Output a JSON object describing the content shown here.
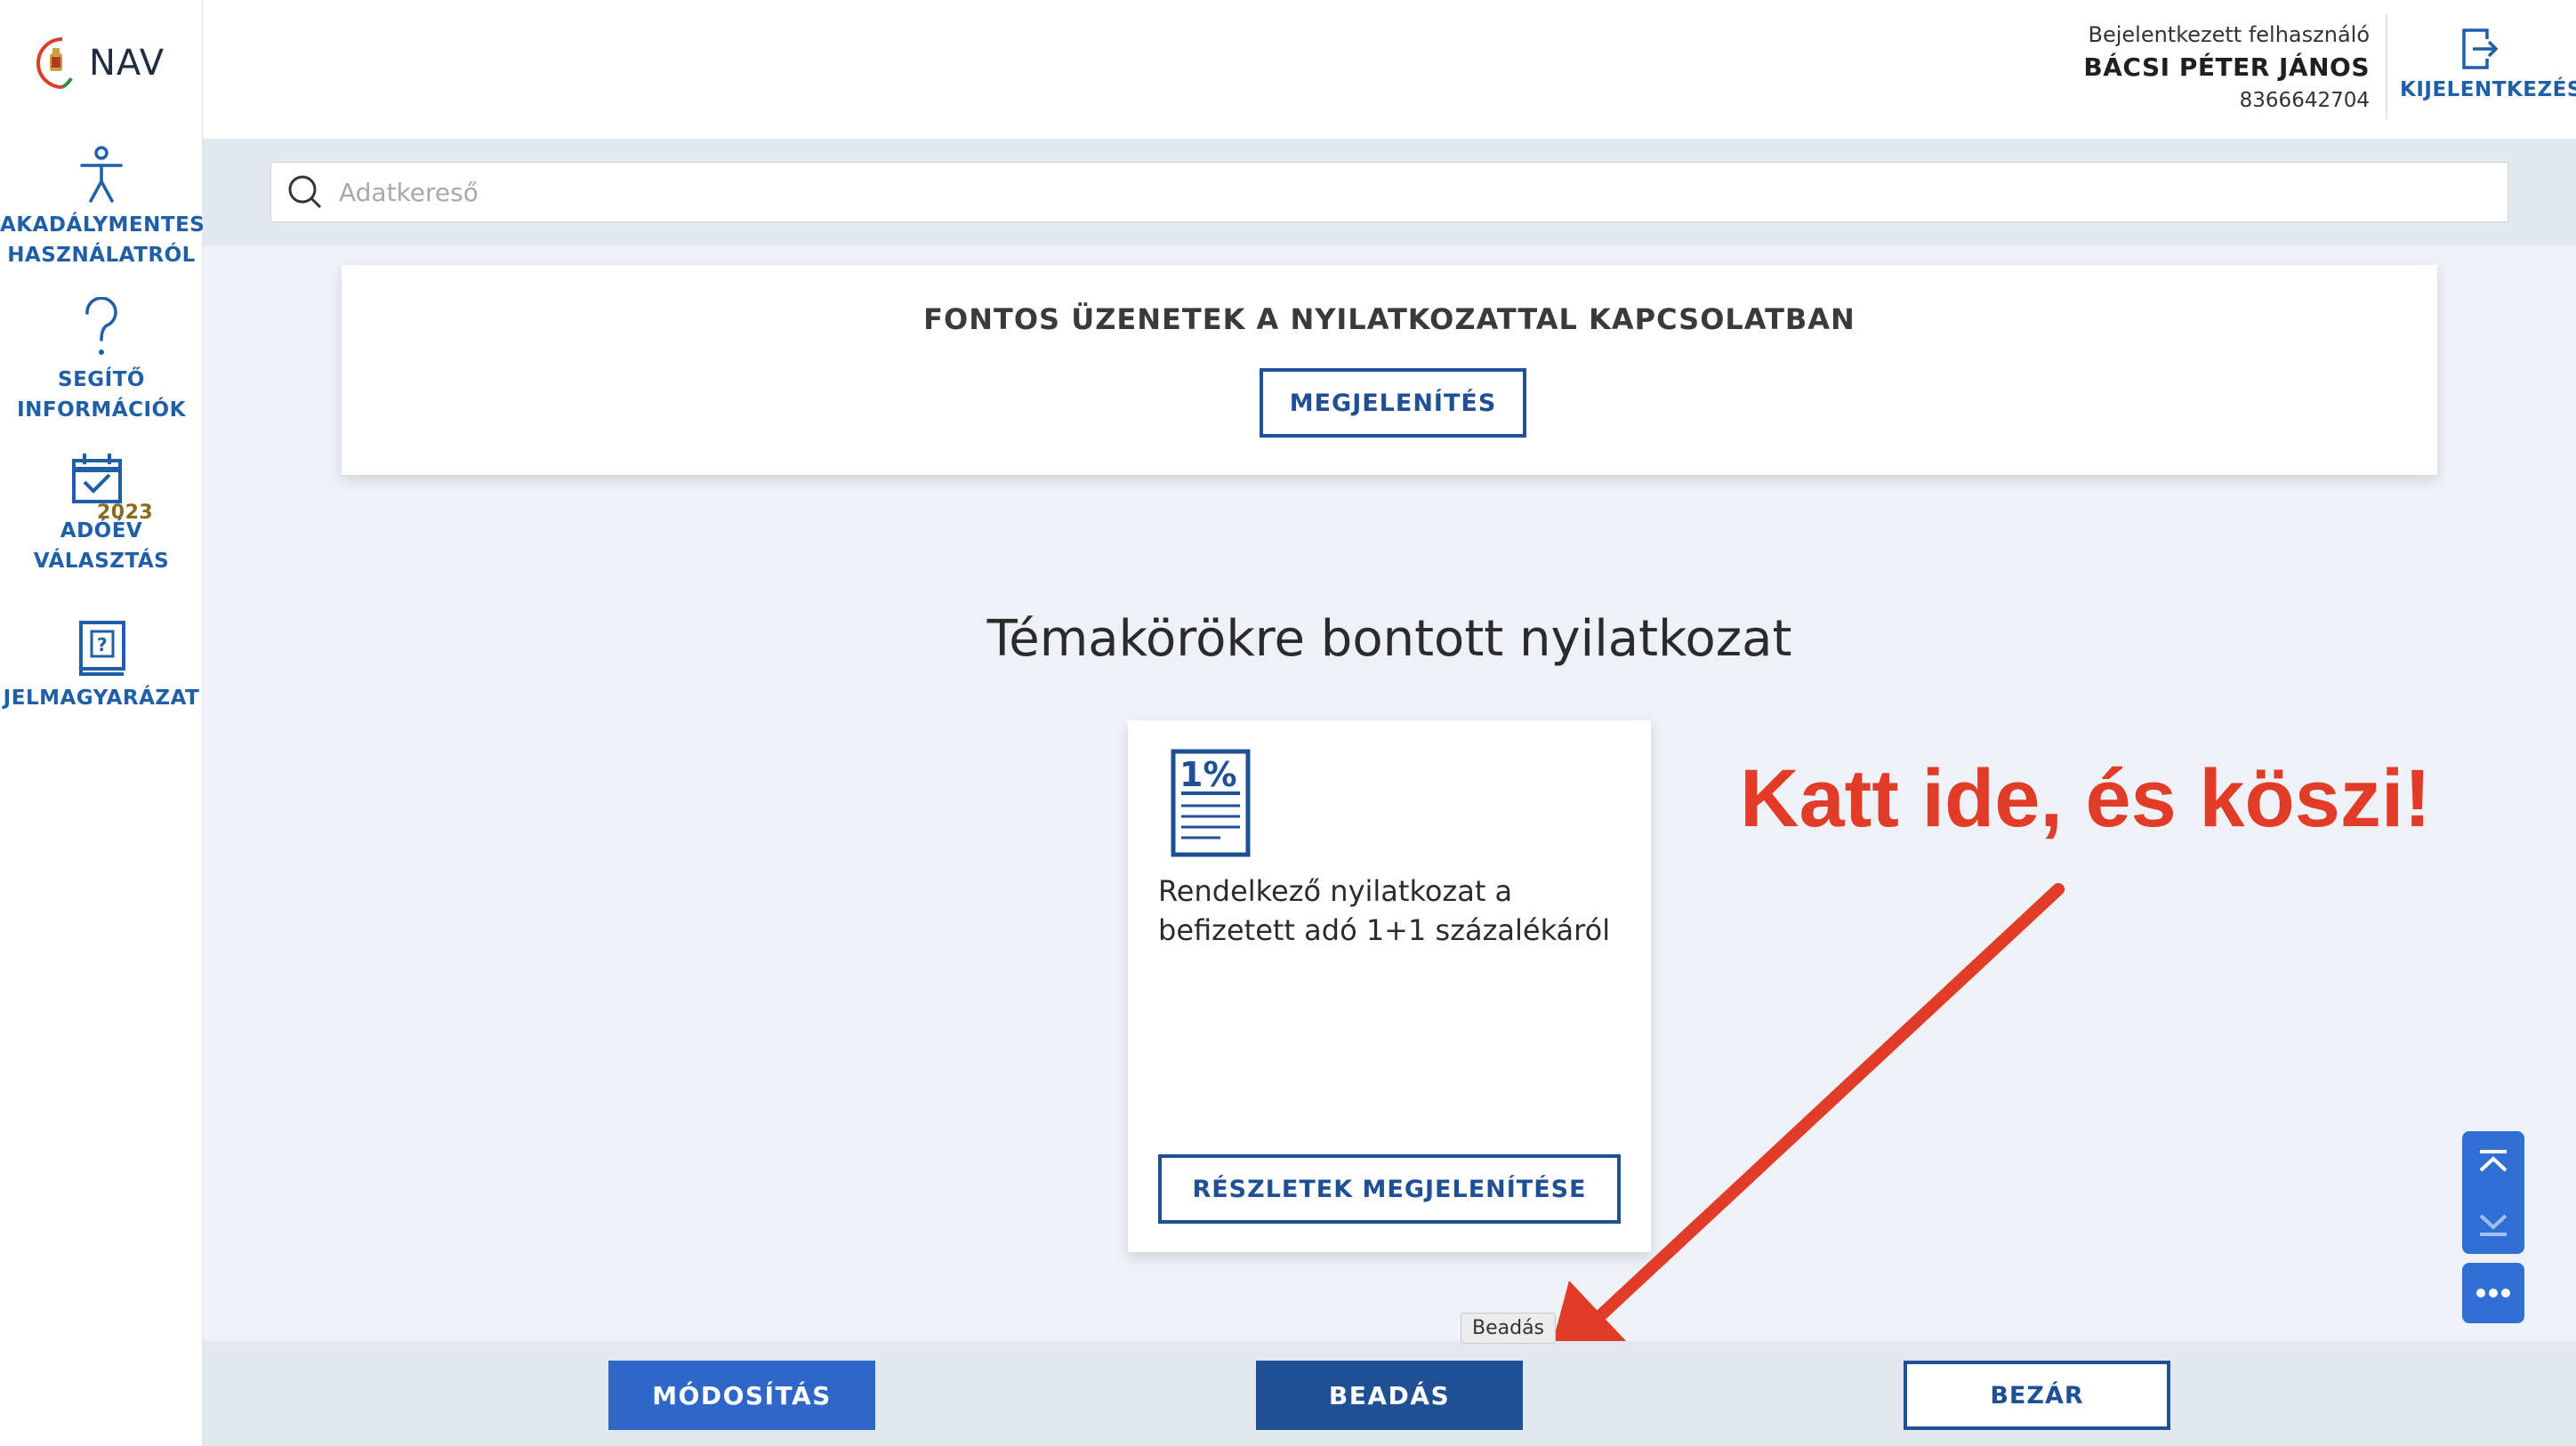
{
  "app": {
    "logo_text": "NAV"
  },
  "sidebar": {
    "items": [
      {
        "line1": "AKADÁLYMENTES",
        "line2": "HASZNÁLATRÓL",
        "icon": "accessibility-icon"
      },
      {
        "line1": "SEGÍTŐ",
        "line2": "INFORMÁCIÓK",
        "icon": "help-icon"
      },
      {
        "line1": "ADÓÉV",
        "line2": "VÁLASZTÁS",
        "icon": "calendar-check-icon",
        "badge": "2023"
      },
      {
        "line1": "JELMAGYARÁZAT",
        "line2": "",
        "icon": "legend-book-icon"
      }
    ]
  },
  "header": {
    "user_caption": "Bejelentkezett felhasználó",
    "user_name": "BÁCSI PÉTER JÁNOS",
    "user_id": "8366642704",
    "logout_label": "KIJELENTKEZÉS"
  },
  "search": {
    "placeholder": "Adatkereső",
    "value": ""
  },
  "messages": {
    "title": "FONTOS ÜZENETEK A NYILATKOZATTAL KAPCSOLATBAN",
    "button_label": "MEGJELENÍTÉS"
  },
  "section": {
    "title": "Témakörökre bontott nyilatkozat"
  },
  "declaration_card": {
    "icon_label": "1%",
    "text": "Rendelkező nyilatkozat a befizetett adó 1+1 százalékáról",
    "button_label": "RÉSZLETEK MEGJELENÍTÉSE"
  },
  "annotation": {
    "text": "Katt ide, és köszi!",
    "color": "#e23b27"
  },
  "footer": {
    "modify_label": "MÓDOSÍTÁS",
    "submit_label": "BEADÁS",
    "close_label": "BEZÁR",
    "submit_tooltip": "Beadás"
  },
  "colors": {
    "primary": "#1f4f95",
    "accent": "#2e66c9",
    "link": "#1f5fa8"
  }
}
